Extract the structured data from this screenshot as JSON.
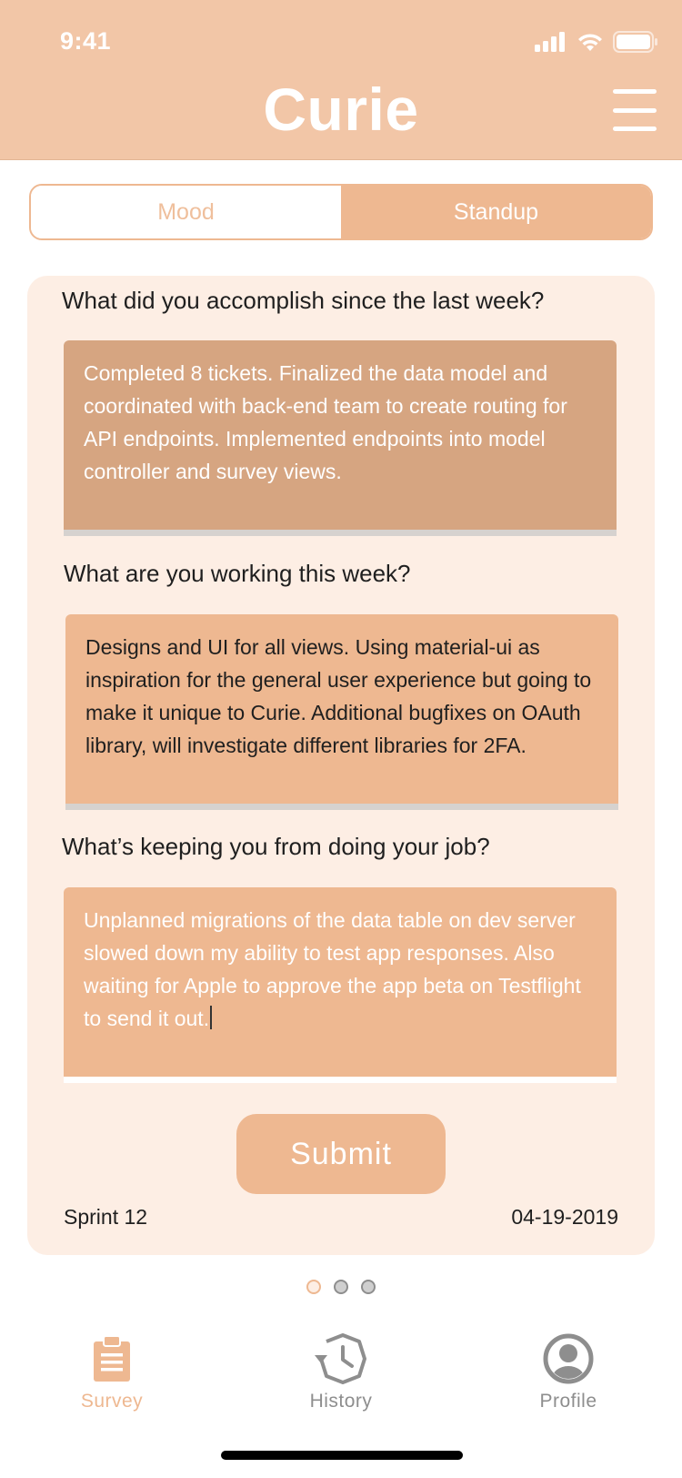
{
  "status_bar": {
    "time": "9:41"
  },
  "header": {
    "title": "Curie"
  },
  "tabs": [
    {
      "label": "Mood",
      "active": false
    },
    {
      "label": "Standup",
      "active": true
    }
  ],
  "survey": {
    "questions": [
      {
        "question": "What did you accomplish since the last week?",
        "answer": "Completed 8 tickets. Finalized the data model and coordinated with back-end team to create routing for API endpoints. Implemented endpoints into model controller and survey views."
      },
      {
        "question": "What are you working this week?",
        "answer": "Designs and UI for all views. Using material-ui as inspiration for the general user experience but going to make it unique to Curie. Additional bugfixes on OAuth library, will investigate different libraries for 2FA."
      },
      {
        "question": "What’s keeping you from doing your job?",
        "answer": "Unplanned migrations of the data table on dev server slowed down my ability to test app responses. Also waiting for Apple to approve the app beta on Testflight to send it out."
      }
    ],
    "submit_label": "Submit",
    "sprint": "Sprint 12",
    "date": "04-19-2019"
  },
  "pagination": {
    "total": 3,
    "current": 1
  },
  "bottom_nav": [
    {
      "label": "Survey",
      "icon": "clipboard-icon",
      "active": true
    },
    {
      "label": "History",
      "icon": "history-icon",
      "active": false
    },
    {
      "label": "Profile",
      "icon": "profile-icon",
      "active": false
    }
  ],
  "colors": {
    "header": "#f2c6a7",
    "accent": "#eeb891",
    "accent_dark": "#d6a581",
    "card_bg": "#fdeee4",
    "inactive_gray": "#8e8e8e"
  }
}
